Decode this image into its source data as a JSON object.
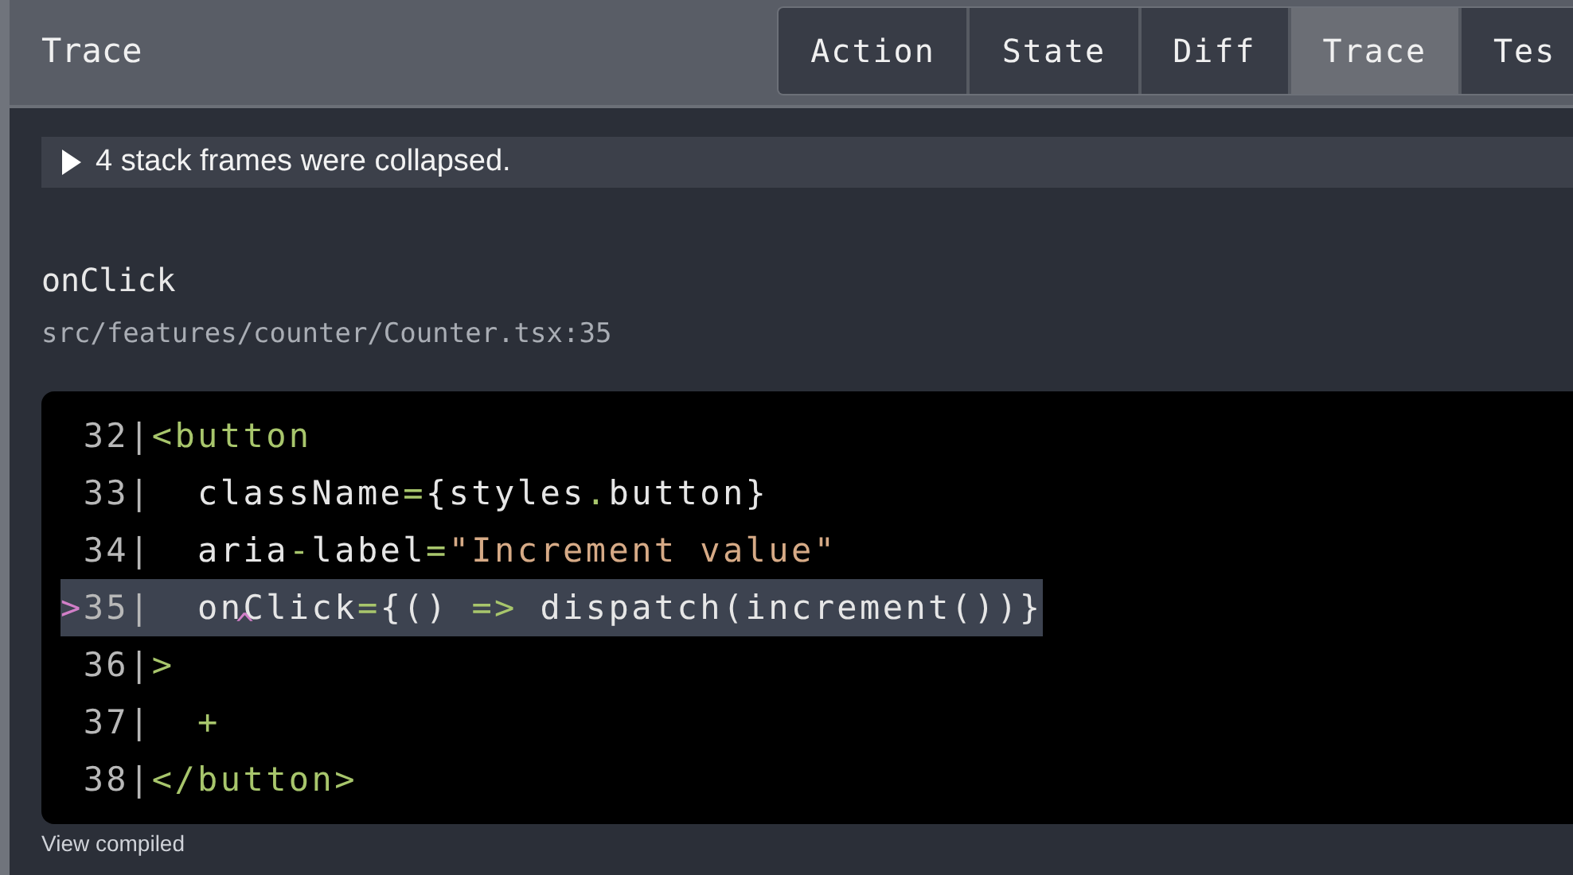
{
  "header": {
    "title": "Trace",
    "tabs": [
      {
        "label": "Action",
        "selected": false
      },
      {
        "label": "State",
        "selected": false
      },
      {
        "label": "Diff",
        "selected": false
      },
      {
        "label": "Trace",
        "selected": true
      },
      {
        "label": "Tes",
        "selected": false
      }
    ]
  },
  "collapsed_frames": {
    "label": "4 stack frames were collapsed.",
    "expanded": false
  },
  "frame": {
    "function": "onClick",
    "location": "src/features/counter/Counter.tsx:35"
  },
  "code": {
    "caret": "^",
    "lines": [
      {
        "number": "32",
        "gutter": "|",
        "selected": false,
        "tokens": [
          {
            "kind": "tag",
            "text": "<button"
          }
        ]
      },
      {
        "number": "33",
        "gutter": "|",
        "selected": false,
        "tokens": [
          {
            "kind": "plain",
            "text": "  className"
          },
          {
            "kind": "op",
            "text": "="
          },
          {
            "kind": "plain",
            "text": "{styles"
          },
          {
            "kind": "op",
            "text": "."
          },
          {
            "kind": "plain",
            "text": "button}"
          }
        ]
      },
      {
        "number": "34",
        "gutter": "|",
        "selected": false,
        "tokens": [
          {
            "kind": "plain",
            "text": "  aria"
          },
          {
            "kind": "op",
            "text": "-"
          },
          {
            "kind": "plain",
            "text": "label"
          },
          {
            "kind": "op",
            "text": "="
          },
          {
            "kind": "string",
            "text": "\"Increment value\""
          }
        ]
      },
      {
        "marker": ">",
        "number": "35",
        "gutter": "|",
        "selected": true,
        "tokens": [
          {
            "kind": "plain",
            "text": "  onClick"
          },
          {
            "kind": "op",
            "text": "="
          },
          {
            "kind": "plain",
            "text": "{() "
          },
          {
            "kind": "op",
            "text": "=>"
          },
          {
            "kind": "plain",
            "text": " dispatch(increment())}"
          }
        ]
      },
      {
        "number": "36",
        "gutter": "|",
        "selected": false,
        "tokens": [
          {
            "kind": "tag",
            "text": ">"
          }
        ]
      },
      {
        "number": "37",
        "gutter": "|",
        "selected": false,
        "tokens": [
          {
            "kind": "op",
            "text": "  +"
          }
        ]
      },
      {
        "number": "38",
        "gutter": "|",
        "selected": false,
        "tokens": [
          {
            "kind": "tag",
            "text": "</button>"
          }
        ]
      }
    ]
  },
  "view_compiled": "View compiled"
}
